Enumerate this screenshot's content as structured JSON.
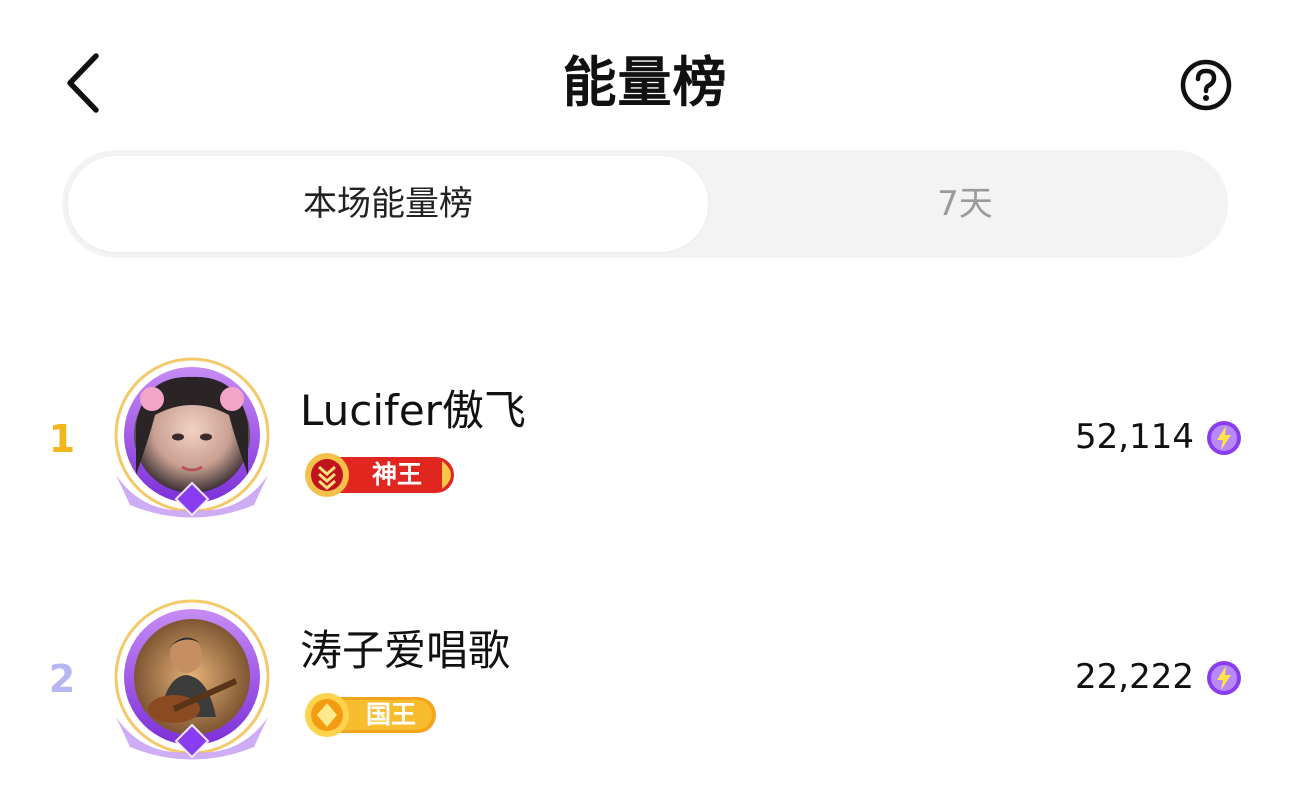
{
  "header": {
    "title": "能量榜"
  },
  "tabs": [
    {
      "label": "本场能量榜",
      "active": true
    },
    {
      "label": "7天",
      "active": false
    }
  ],
  "ranking": [
    {
      "rank": "1",
      "name": "Lucifer傲飞",
      "badge": "神王",
      "score": "52,114",
      "rank_color": "#f2b61e"
    },
    {
      "rank": "2",
      "name": "涛子爱唱歌",
      "badge": "国王",
      "score": "22,222",
      "rank_color": "#b5b6f3"
    }
  ],
  "colors": {
    "badge_god_king": "#e0261f",
    "badge_king": "#f4a51c",
    "avatar_frame": "#9b4dea",
    "energy_icon": "#8a3df0"
  },
  "icons": {
    "back": "chevron-left-icon",
    "help": "question-circle-icon",
    "energy": "lightning-icon"
  }
}
